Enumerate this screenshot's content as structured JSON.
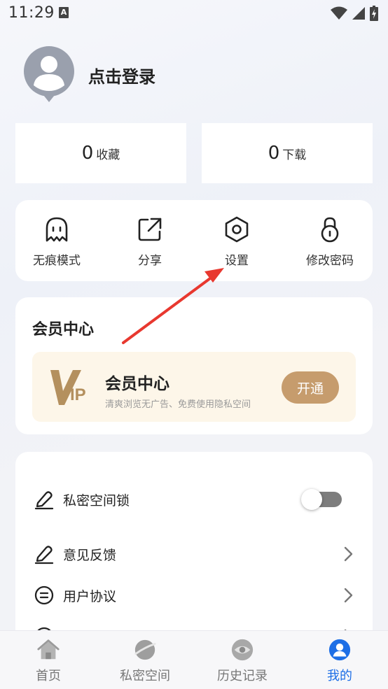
{
  "status_bar": {
    "time": "11:29",
    "notification_letter": "A"
  },
  "profile": {
    "login_text": "点击登录"
  },
  "stats": [
    {
      "count": "0",
      "label": "收藏"
    },
    {
      "count": "0",
      "label": "下载"
    }
  ],
  "quick_actions": [
    {
      "label": "无痕模式",
      "icon": "ghost-icon"
    },
    {
      "label": "分享",
      "icon": "share-icon"
    },
    {
      "label": "设置",
      "icon": "settings-hexagon-icon"
    },
    {
      "label": "修改密码",
      "icon": "lock-icon"
    }
  ],
  "vip": {
    "section_title": "会员中心",
    "card_title": "会员中心",
    "card_desc": "清爽浏览无广告、免费使用隐私空间",
    "button_label": "开通",
    "logo_text": "IP",
    "accent_color": "#c69c6d"
  },
  "settings_list": [
    {
      "label": "私密空间锁",
      "icon": "pen-icon",
      "control": "toggle",
      "on": false
    },
    {
      "label": "意见反馈",
      "icon": "pen-icon",
      "control": "chevron"
    },
    {
      "label": "用户协议",
      "icon": "document-circle-icon",
      "control": "chevron"
    }
  ],
  "bottom_nav": [
    {
      "label": "首页",
      "icon": "home-icon",
      "active": false
    },
    {
      "label": "私密空间",
      "icon": "planet-icon",
      "active": false
    },
    {
      "label": "历史记录",
      "icon": "eye-icon",
      "active": false
    },
    {
      "label": "我的",
      "icon": "user-icon",
      "active": true
    }
  ],
  "colors": {
    "active_nav": "#1e6fe6",
    "annotation_arrow": "#e8382f"
  }
}
